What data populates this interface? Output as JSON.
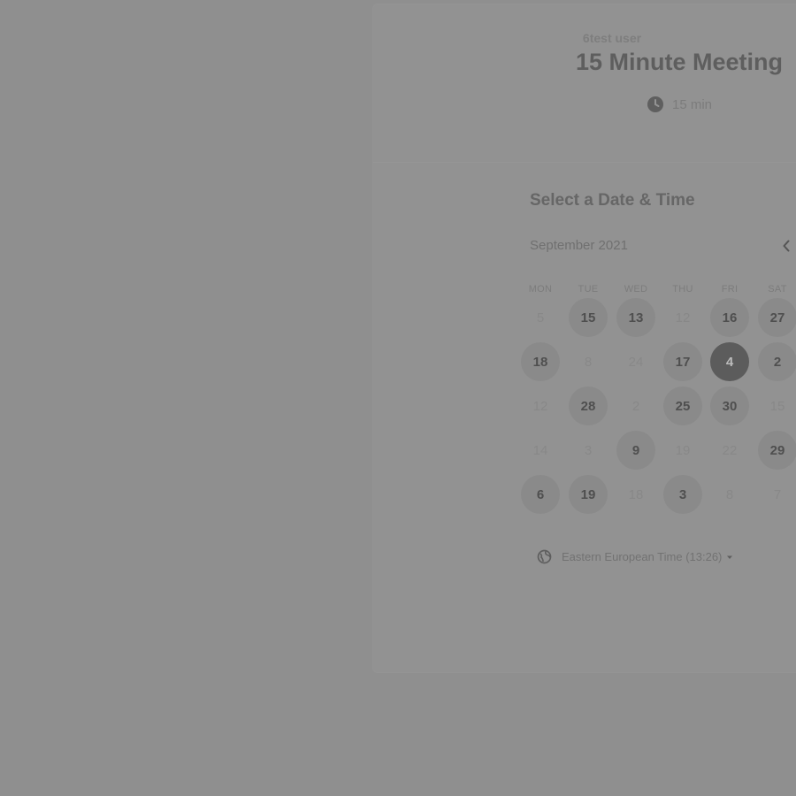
{
  "event": {
    "owner": "6test user",
    "title": "15 Minute Meeting",
    "duration": "15 min"
  },
  "scheduler": {
    "heading": "Select a Date & Time",
    "month": "September 2021",
    "weekdays": [
      "MON",
      "TUE",
      "WED",
      "THU",
      "FRI",
      "SAT"
    ],
    "rows": [
      [
        {
          "label": "5",
          "state": "off"
        },
        {
          "label": "15",
          "state": "available"
        },
        {
          "label": "13",
          "state": "available"
        },
        {
          "label": "12",
          "state": "off"
        },
        {
          "label": "16",
          "state": "available"
        },
        {
          "label": "27",
          "state": "available"
        }
      ],
      [
        {
          "label": "18",
          "state": "available"
        },
        {
          "label": "8",
          "state": "off"
        },
        {
          "label": "24",
          "state": "off"
        },
        {
          "label": "17",
          "state": "available"
        },
        {
          "label": "4",
          "state": "selected"
        },
        {
          "label": "2",
          "state": "available"
        }
      ],
      [
        {
          "label": "12",
          "state": "off"
        },
        {
          "label": "28",
          "state": "available"
        },
        {
          "label": "2",
          "state": "off"
        },
        {
          "label": "25",
          "state": "available"
        },
        {
          "label": "30",
          "state": "available"
        },
        {
          "label": "15",
          "state": "off"
        }
      ],
      [
        {
          "label": "14",
          "state": "off"
        },
        {
          "label": "3",
          "state": "off"
        },
        {
          "label": "9",
          "state": "available"
        },
        {
          "label": "19",
          "state": "off"
        },
        {
          "label": "22",
          "state": "off"
        },
        {
          "label": "29",
          "state": "available"
        }
      ],
      [
        {
          "label": "6",
          "state": "available"
        },
        {
          "label": "19",
          "state": "available"
        },
        {
          "label": "18",
          "state": "off"
        },
        {
          "label": "3",
          "state": "available"
        },
        {
          "label": "8",
          "state": "off"
        },
        {
          "label": "7",
          "state": "off"
        }
      ]
    ],
    "timezone": "Eastern European Time (13:26)"
  },
  "icons": {
    "clock": "clock-icon",
    "previous": "chevron-left-icon",
    "globe": "globe-icon",
    "caret": "caret-down-icon"
  },
  "colors": {
    "overlay": "#8f8f8f",
    "selected_day": "#5c5c5c",
    "available_day": "#8a8a8a"
  }
}
